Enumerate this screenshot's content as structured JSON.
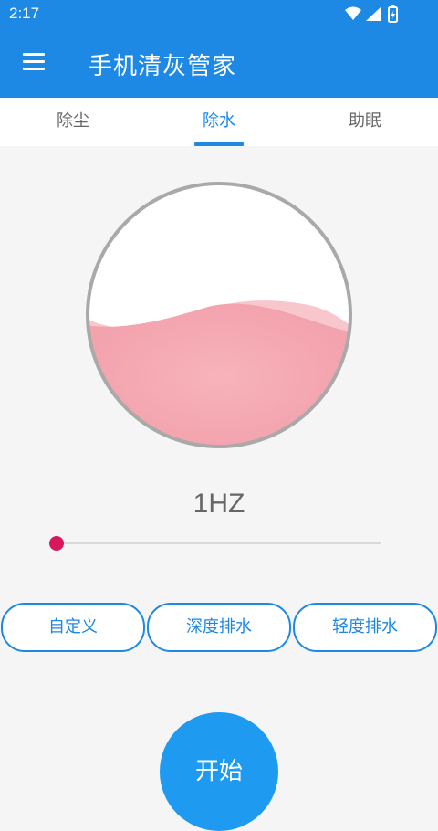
{
  "status_bar": {
    "time": "2:17",
    "icons": [
      "wifi-icon",
      "signal-icon",
      "battery-icon"
    ]
  },
  "app_bar": {
    "menu_icon": "menu-icon",
    "title": "手机清灰管家"
  },
  "tabs": [
    {
      "label": "除尘",
      "active": false
    },
    {
      "label": "除水",
      "active": true
    },
    {
      "label": "助眠",
      "active": false
    }
  ],
  "gauge": {
    "fill_level": 0.52
  },
  "frequency": {
    "label": "1HZ",
    "slider_value": 0
  },
  "modes": [
    {
      "label": "自定义"
    },
    {
      "label": "深度排水"
    },
    {
      "label": "轻度排水"
    }
  ],
  "start_button": {
    "label": "开始"
  },
  "colors": {
    "primary": "#1e88e5",
    "accent": "#d6185f",
    "water": "#f3a3ad",
    "ring": "#a9a9a9"
  }
}
